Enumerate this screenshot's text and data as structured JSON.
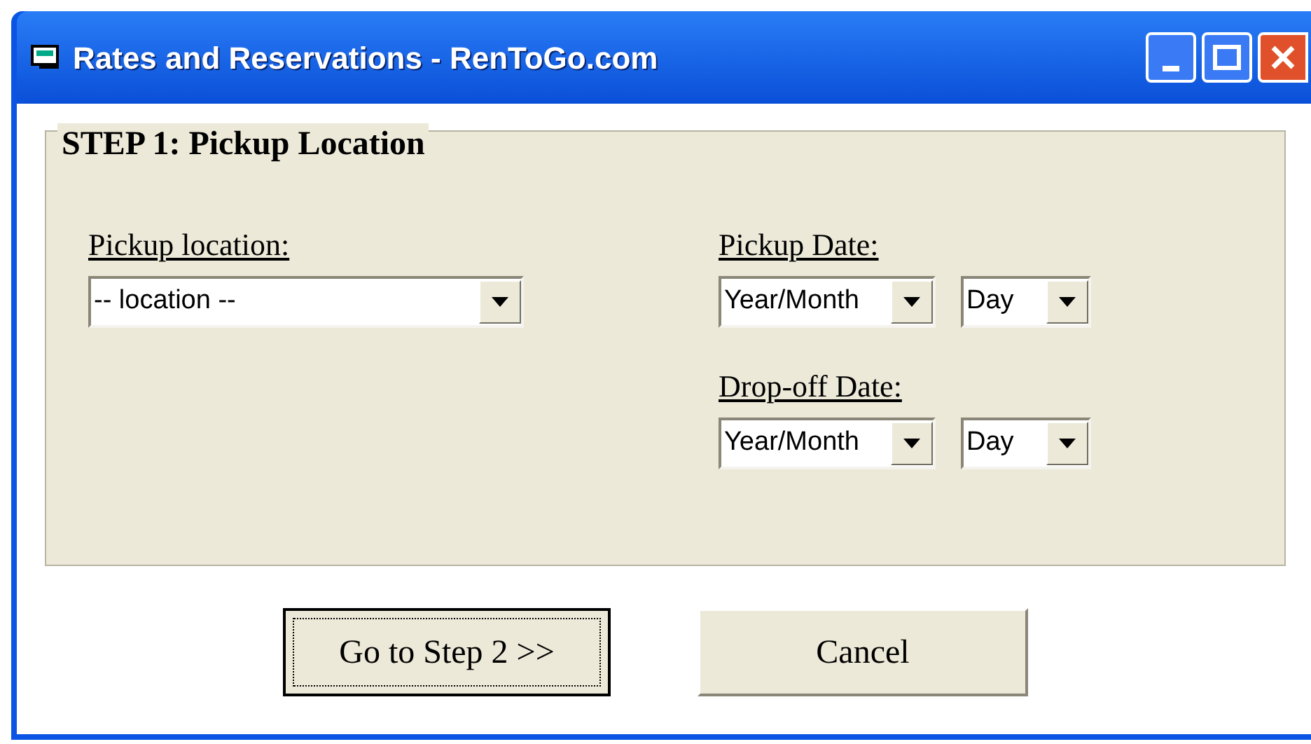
{
  "window": {
    "title": "Rates and Reservations - RenToGo.com"
  },
  "step": {
    "legend": "STEP 1: Pickup Location",
    "location": {
      "label": "Pickup location:",
      "value": "-- location --"
    },
    "dates": [
      {
        "label": "Pickup Date:",
        "month": "Year/Month",
        "day": "Day"
      },
      {
        "label": "Drop-off Date:",
        "month": "Year/Month",
        "day": "Day"
      }
    ]
  },
  "buttons": [
    {
      "label": "Go to Step 2 >>",
      "focused": true
    },
    {
      "label": "Cancel",
      "focused": false
    }
  ]
}
